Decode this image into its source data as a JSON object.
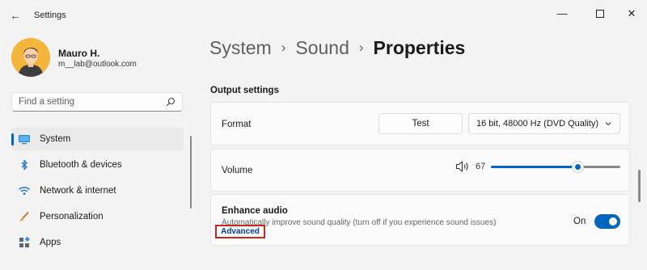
{
  "window": {
    "title": "Settings"
  },
  "user": {
    "name": "Mauro H.",
    "email": "m__lab@outlook.com"
  },
  "search": {
    "placeholder": "Find a setting"
  },
  "nav": {
    "items": [
      {
        "label": "System",
        "icon": "system-icon",
        "active": true
      },
      {
        "label": "Bluetooth & devices",
        "icon": "bluetooth-icon"
      },
      {
        "label": "Network & internet",
        "icon": "wifi-icon"
      },
      {
        "label": "Personalization",
        "icon": "brush-icon"
      },
      {
        "label": "Apps",
        "icon": "apps-icon"
      }
    ]
  },
  "breadcrumb": {
    "items": [
      "System",
      "Sound"
    ],
    "current": "Properties"
  },
  "output": {
    "section_title": "Output settings",
    "format_label": "Format",
    "test_button": "Test",
    "format_value": "16 bit, 48000 Hz (DVD Quality)",
    "volume_label": "Volume",
    "volume_value": "67",
    "enhance_title": "Enhance audio",
    "enhance_desc": "Automatically improve sound quality (turn off if you experience sound issues)",
    "advanced_link": "Advanced",
    "toggle_label": "On"
  },
  "colors": {
    "accent": "#0067c0",
    "highlight_box": "#c42b1c"
  }
}
